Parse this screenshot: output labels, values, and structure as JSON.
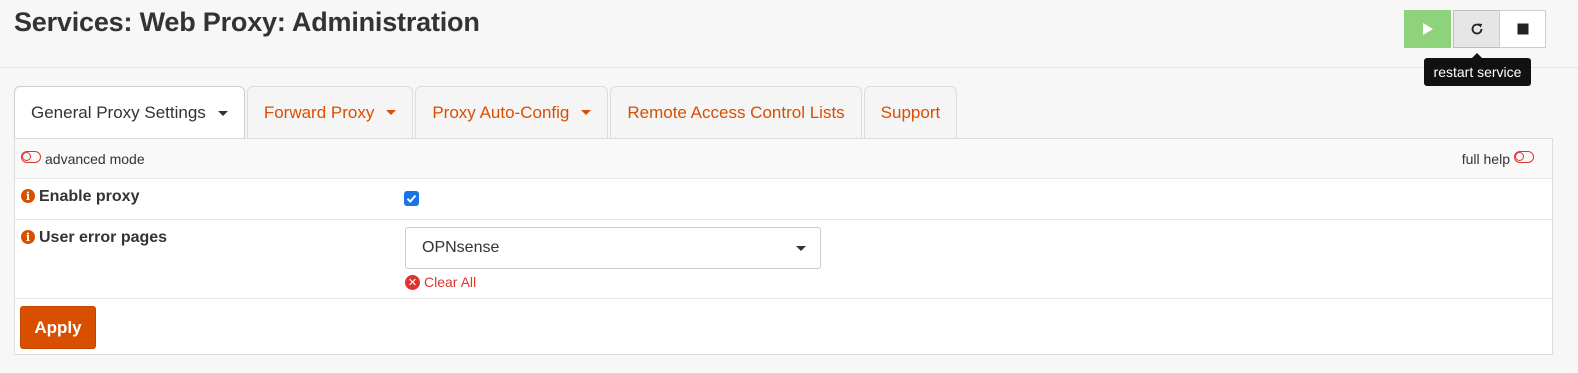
{
  "header": {
    "title": "Services: Web Proxy: Administration",
    "service_buttons": {
      "start_icon": "play-icon",
      "restart_icon": "refresh-icon",
      "stop_icon": "stop-icon",
      "start_color": "#8fd27c"
    },
    "tooltip": "restart service"
  },
  "tabs": [
    {
      "label": "General Proxy Settings",
      "active": true,
      "dropdown": true
    },
    {
      "label": "Forward Proxy",
      "active": false,
      "dropdown": true
    },
    {
      "label": "Proxy Auto-Config",
      "active": false,
      "dropdown": true
    },
    {
      "label": "Remote Access Control Lists",
      "active": false,
      "dropdown": false
    },
    {
      "label": "Support",
      "active": false,
      "dropdown": false
    }
  ],
  "form": {
    "advanced_mode_label": "advanced mode",
    "full_help_label": "full help",
    "enable_proxy": {
      "label": "Enable proxy",
      "checked": true,
      "info_icon": "i"
    },
    "user_error_pages": {
      "label": "User error pages",
      "value": "OPNsense",
      "info_icon": "i"
    },
    "clear_all_label": "Clear All",
    "apply_label": "Apply"
  },
  "colors": {
    "accent": "#d94f00",
    "danger": "#e0342f",
    "checkbox": "#1a73e8"
  }
}
